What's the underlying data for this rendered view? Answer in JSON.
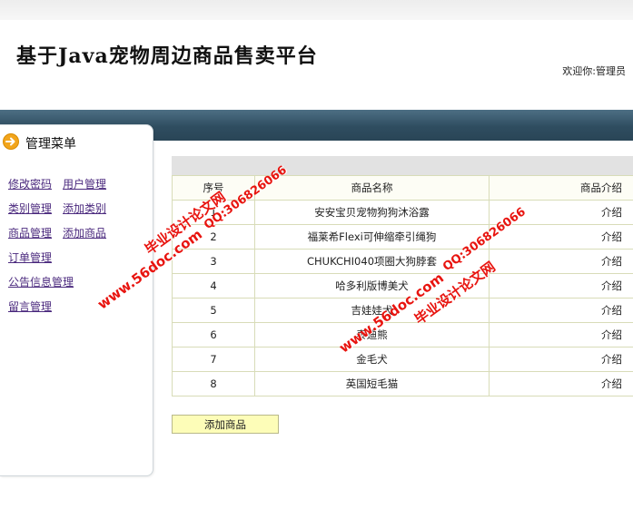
{
  "header": {
    "site_title": "基于Java宠物周边商品售卖平台",
    "welcome": "欢迎你:管理员"
  },
  "sidebar": {
    "title": "管理菜单",
    "rows": [
      [
        "修改密码",
        "用户管理"
      ],
      [
        "类别管理",
        "添加类别"
      ],
      [
        "商品管理",
        "添加商品"
      ],
      [
        "订单管理"
      ],
      [
        "公告信息管理"
      ],
      [
        "留言管理"
      ]
    ]
  },
  "table": {
    "headers": [
      "序号",
      "商品名称",
      "商品介绍"
    ],
    "rows": [
      {
        "index": "1",
        "name": "安安宝贝宠物狗狗沐浴露",
        "intro": "介绍"
      },
      {
        "index": "2",
        "name": "福莱希Flexi可伸缩牵引绳狗",
        "intro": "介绍"
      },
      {
        "index": "3",
        "name": "CHUKCHI040项圈大狗脖套",
        "intro": "介绍"
      },
      {
        "index": "4",
        "name": "哈多利版博美犬",
        "intro": "介绍"
      },
      {
        "index": "5",
        "name": "吉娃娃犬",
        "intro": "介绍"
      },
      {
        "index": "6",
        "name": "泰迪熊",
        "intro": "介绍"
      },
      {
        "index": "7",
        "name": "金毛犬",
        "intro": "介绍"
      },
      {
        "index": "8",
        "name": "英国短毛猫",
        "intro": "介绍"
      }
    ]
  },
  "add_button": "添加商品",
  "watermark": {
    "site": "www.56doc.com",
    "brand": "毕业设计论文网",
    "qq": "QQ:306826066"
  },
  "colors": {
    "navbar": "#2f4d60",
    "menu_link": "#4b2a7e",
    "watermark": "#e8140f",
    "button_bg": "#fdfdb8"
  }
}
